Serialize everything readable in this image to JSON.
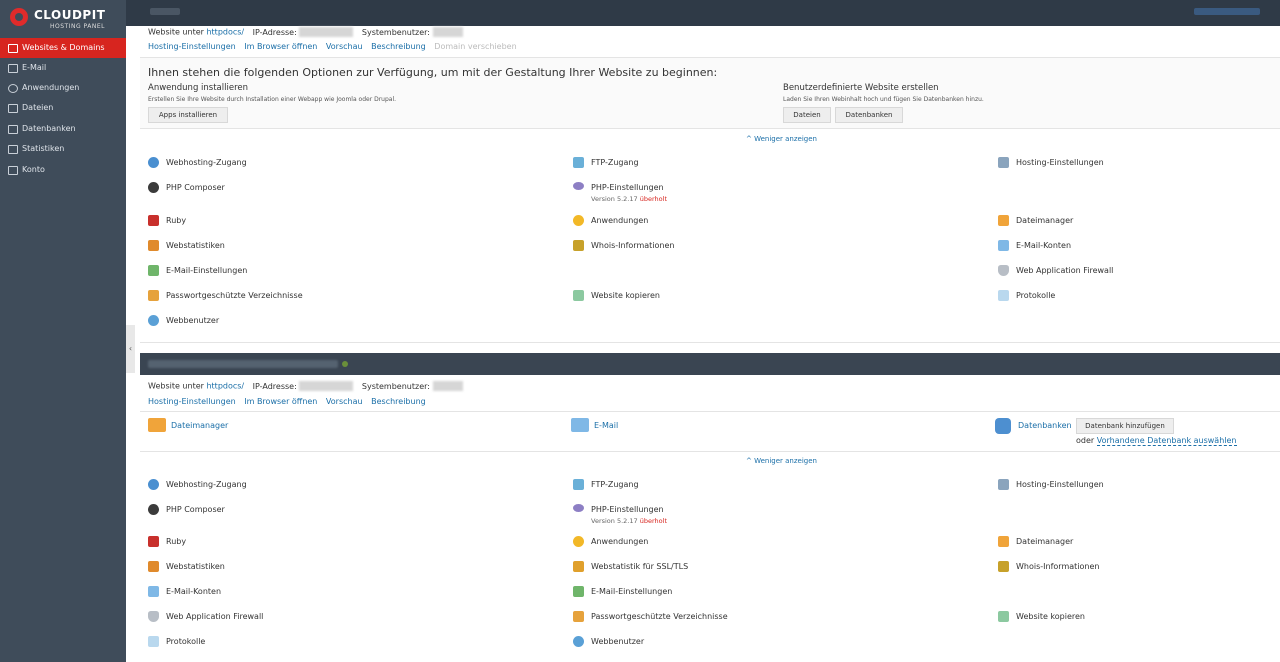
{
  "sidebar": {
    "logo_brand": "CLOUDPIT",
    "logo_sub": "HOSTING PANEL",
    "items": [
      {
        "label": "Websites & Domains",
        "icon": "monitor-icon"
      },
      {
        "label": "E-Mail",
        "icon": "mail-icon"
      },
      {
        "label": "Anwendungen",
        "icon": "gear-icon"
      },
      {
        "label": "Dateien",
        "icon": "folder-icon"
      },
      {
        "label": "Datenbanken",
        "icon": "database-icon"
      },
      {
        "label": "Statistiken",
        "icon": "chart-icon"
      },
      {
        "label": "Konto",
        "icon": "user-icon"
      }
    ],
    "collapse_glyph": "‹"
  },
  "site1": {
    "website_prefix": "Website unter",
    "httpdocs": "httpdocs/",
    "ip_label": "IP-Adresse:",
    "sysuser_label": "Systembenutzer:",
    "links": [
      "Hosting-Einstellungen",
      "Im Browser öffnen",
      "Vorschau",
      "Beschreibung",
      "Domain verschieben"
    ],
    "intro": "Ihnen stehen die folgenden Optionen zur Verfügung, um mit der Gestaltung Ihrer Website zu beginnen:",
    "app_title": "Anwendung installieren",
    "app_desc": "Erstellen Sie Ihre Website durch Installation einer Webapp wie Joomla oder Drupal.",
    "app_button": "Apps installieren",
    "custom_title": "Benutzerdefinierte Website erstellen",
    "custom_desc": "Laden Sie Ihren Webinhalt hoch und fügen Sie Datenbanken hinzu.",
    "files_button": "Dateien",
    "db_button": "Datenbanken",
    "toggle": "^ Weniger anzeigen",
    "tools": {
      "webhosting": "Webhosting-Zugang",
      "ftp": "FTP-Zugang",
      "hosting": "Hosting-Einstellungen",
      "composer": "PHP Composer",
      "php": "PHP-Einstellungen",
      "php_version": "Version 5.2.17",
      "php_outdated": "überholt",
      "ruby": "Ruby",
      "apps": "Anwendungen",
      "filemanager": "Dateimanager",
      "webstats": "Webstatistiken",
      "whois": "Whois-Informationen",
      "mailaccounts": "E-Mail-Konten",
      "mailsettings": "E-Mail-Einstellungen",
      "waf": "Web Application Firewall",
      "protected": "Passwortgeschützte Verzeichnisse",
      "copy": "Website kopieren",
      "logs": "Protokolle",
      "webusers": "Webbenutzer"
    }
  },
  "site2": {
    "website_prefix": "Website unter",
    "httpdocs": "httpdocs/",
    "ip_label": "IP-Adresse:",
    "sysuser_label": "Systembenutzer:",
    "links": [
      "Hosting-Einstellungen",
      "Im Browser öffnen",
      "Vorschau",
      "Beschreibung"
    ],
    "filemanager": "Dateimanager",
    "email": "E-Mail",
    "databases": "Datenbanken",
    "add_db_button": "Datenbank hinzufügen",
    "or": "oder",
    "existing_db": "Vorhandene Datenbank auswählen",
    "toggle": "^ Weniger anzeigen",
    "tools": {
      "webhosting": "Webhosting-Zugang",
      "ftp": "FTP-Zugang",
      "hosting": "Hosting-Einstellungen",
      "composer": "PHP Composer",
      "php": "PHP-Einstellungen",
      "php_version": "Version 5.2.17",
      "php_outdated": "überholt",
      "ruby": "Ruby",
      "apps": "Anwendungen",
      "filemanager": "Dateimanager",
      "webstats": "Webstatistiken",
      "ssl_stats": "Webstatistik für SSL/TLS",
      "whois": "Whois-Informationen",
      "mailaccounts": "E-Mail-Konten",
      "mailsettings": "E-Mail-Einstellungen",
      "waf": "Web Application Firewall",
      "protected": "Passwortgeschützte Verzeichnisse",
      "copy": "Website kopieren",
      "logs": "Protokolle",
      "webusers": "Webbenutzer"
    }
  },
  "colors": {
    "accent": "#d7251f",
    "link": "#1b6fa8",
    "sidebar": "#3f4c5a",
    "topbar": "#2f3a47"
  }
}
